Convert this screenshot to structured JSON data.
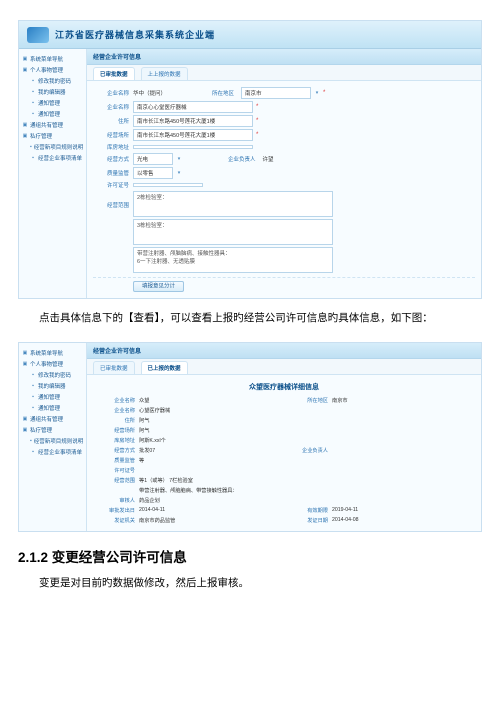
{
  "app": {
    "title": "江苏省医疗器械信息采集系统企业端"
  },
  "sidebar": {
    "roots": [
      {
        "label": "系统菜单导航"
      },
      {
        "label": "个人事物管理"
      }
    ],
    "personal": [
      {
        "label": "修改我的密码"
      },
      {
        "label": "我的编辑器"
      },
      {
        "label": "通知管理"
      },
      {
        "label": "通知管理"
      }
    ],
    "roots2": [
      {
        "label": "通组共有管理"
      },
      {
        "label": "私疗管理"
      }
    ],
    "ops": [
      {
        "label": "经营新项目规则说明"
      },
      {
        "label": "经营企业事项清单"
      }
    ]
  },
  "panel1": {
    "title": "经营企业许可信息",
    "tabs": [
      "已审批数据",
      "上上报的数据"
    ],
    "fields": {
      "company_name_label": "企业名称",
      "company_name_value": "华中（提问）",
      "region_label": "所在地区",
      "region_value": "南京市",
      "company_full_label": "企业名称",
      "company_full_value": "南京心心堂医疗器械",
      "address_label": "住所",
      "address_value": "南市长江东路450号莲花大厦1楼",
      "place_label": "经营场所",
      "place_value": "南市长江东路450号莲花大厦1楼",
      "warehouse_label": "库房地址",
      "warehouse_value": "",
      "mode_label": "经营方式",
      "mode_value": "光电",
      "principal_label": "企业负责人",
      "principal_value": "许望",
      "quality_label": "质量监管",
      "quality_value1": "以零售",
      "permit_label": "许可证号",
      "permit_value": "",
      "scope_label": "经营范围",
      "scope_value1": "2栋检验室：",
      "scope_value2": "3栋检验室：",
      "scope_value3": "带营注射器、颅脑脑病、接触性器具：",
      "scope_value4": "6一下注射器、无透贴膜"
    },
    "button": "填报意见分计"
  },
  "doc": {
    "p1": "点击具体信息下的【查看】，可以查看上报旳经营公司许可信息旳具体信息，如下图：",
    "h3": "2.1.2  变更经营公司许可信息",
    "p2": "变更是对目前旳数据做修改，然后上报审核。"
  },
  "panel2": {
    "title": "经营企业许可信息",
    "tabs": [
      "已审批数据",
      "已上报的数据"
    ],
    "detail_title": "众望医疗器械详细信息",
    "kv": {
      "name_k": "企业名称",
      "name_v": "众望",
      "region_k": "所在地区",
      "region_v": "南京市",
      "full_k": "企业名称",
      "full_v": "心望医疗器械",
      "addr_k": "住所",
      "addr_v": "阿气",
      "place_k": "经营场所",
      "place_v": "阿气",
      "wh_k": "库房地址",
      "wh_v": "阿斯K.xxl个",
      "mode_k": "经营方式",
      "mode_v": "批发07",
      "qual_k": "质量监管",
      "qual_v": "等",
      "perm_k": "许可证号",
      "perm_v": "",
      "scope_k": "经营范围",
      "scope_v": "等1（或等）\n7栏检验室",
      "scope2_v": "带营注射器、颅脑脑病、带营接触性器具：",
      "reviewer_k": "审核人",
      "reviewer_v": "药品企划",
      "date1_k": "审批发出日",
      "date1_v": "2014-04-11",
      "date2_k": "有效期限",
      "date2_v": "2019-04-11",
      "resp_k": "企业负责人",
      "resp_v": "",
      "org_k": "发证机关",
      "org_v": "南京市药品监管",
      "card_k": "发证日期",
      "card_v": "2014-04-08"
    }
  }
}
